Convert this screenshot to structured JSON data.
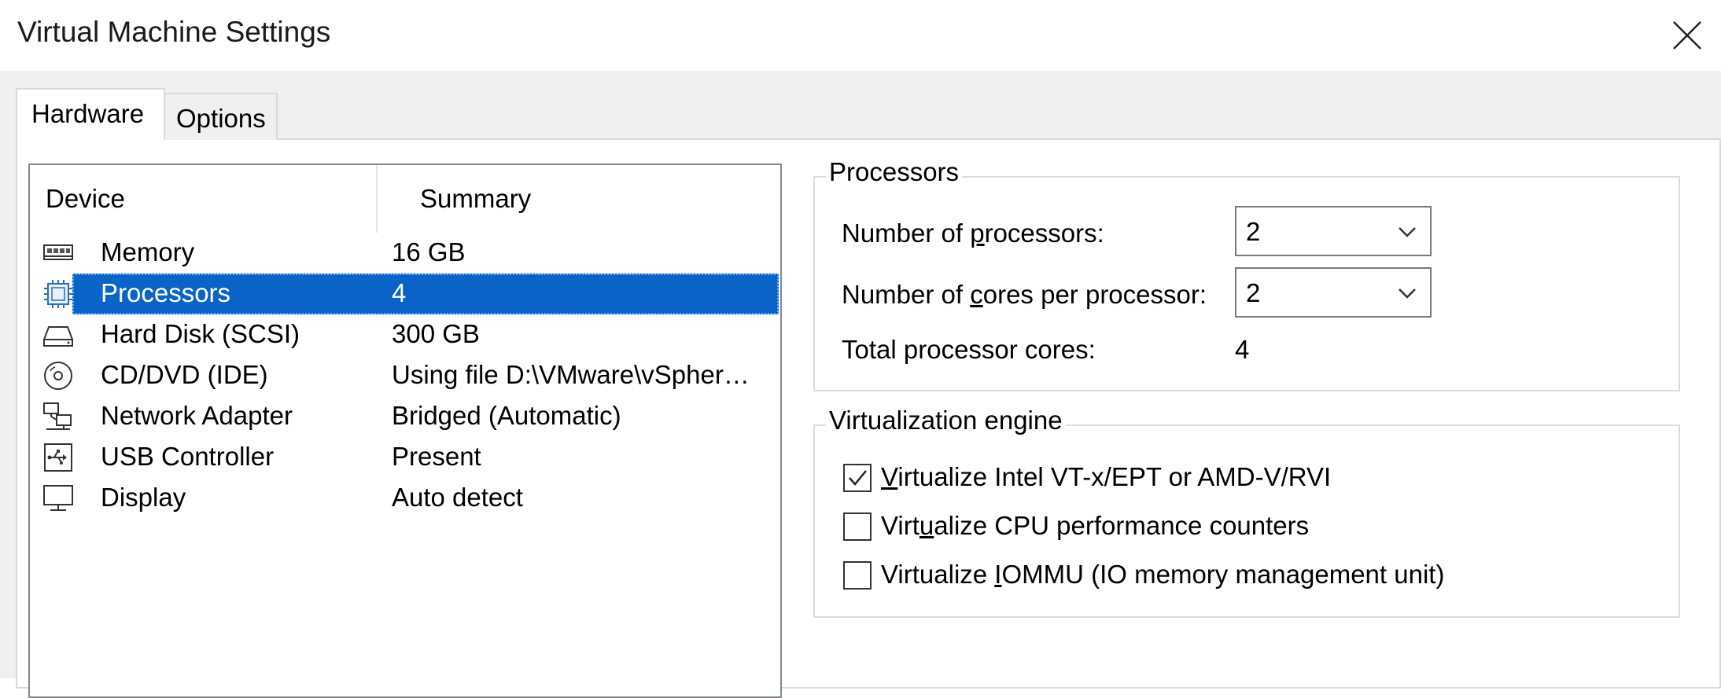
{
  "window": {
    "title": "Virtual Machine Settings"
  },
  "tabs": [
    {
      "label": "Hardware",
      "active": true
    },
    {
      "label": "Options",
      "active": false
    }
  ],
  "device_list": {
    "headers": {
      "device": "Device",
      "summary": "Summary"
    },
    "rows": [
      {
        "icon": "memory-icon",
        "device": "Memory",
        "summary": "16 GB",
        "selected": false
      },
      {
        "icon": "processor-icon",
        "device": "Processors",
        "summary": "4",
        "selected": true
      },
      {
        "icon": "hard-disk-icon",
        "device": "Hard Disk (SCSI)",
        "summary": "300 GB",
        "selected": false
      },
      {
        "icon": "cd-dvd-icon",
        "device": "CD/DVD (IDE)",
        "summary": "Using file D:\\VMware\\vSpher…",
        "selected": false
      },
      {
        "icon": "network-adapter-icon",
        "device": "Network Adapter",
        "summary": "Bridged (Automatic)",
        "selected": false
      },
      {
        "icon": "usb-controller-icon",
        "device": "USB Controller",
        "summary": "Present",
        "selected": false
      },
      {
        "icon": "display-icon",
        "device": "Display",
        "summary": "Auto detect",
        "selected": false
      }
    ]
  },
  "processors": {
    "legend": "Processors",
    "num_processors_label_pre": "Number of ",
    "num_processors_label_accel": "p",
    "num_processors_label_post": "rocessors:",
    "num_processors_value": "2",
    "cores_label_pre": "Number of ",
    "cores_label_accel": "c",
    "cores_label_post": "ores per processor:",
    "cores_value": "2",
    "total_label": "Total processor cores:",
    "total_value": "4"
  },
  "virtualization": {
    "legend": "Virtualization engine",
    "options": [
      {
        "accel": "V",
        "rest_pre": "",
        "rest": "irtualize Intel VT-x/EPT or AMD-V/RVI",
        "checked": true
      },
      {
        "pre": "Virt",
        "accel": "u",
        "rest": "alize CPU performance counters",
        "checked": false
      },
      {
        "pre": "Virtualize ",
        "accel": "I",
        "rest": "OMMU (IO memory management unit)",
        "checked": false
      }
    ]
  },
  "colors": {
    "selection": "#0a64c8",
    "panel_bg": "#f0f0f0",
    "border": "#d9d9d9"
  }
}
